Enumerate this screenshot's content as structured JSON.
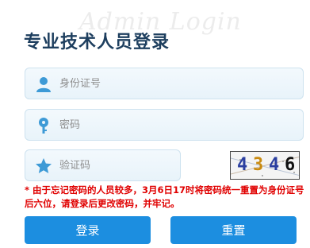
{
  "watermark": "Admin Login",
  "title": "专业技术人员登录",
  "fields": {
    "username": {
      "placeholder": "身份证号",
      "value": "",
      "icon": "user-icon"
    },
    "password": {
      "placeholder": "密码",
      "value": "",
      "icon": "key-icon"
    },
    "captcha": {
      "placeholder": "验证码",
      "value": "",
      "icon": "star-icon"
    }
  },
  "captcha_image": {
    "digits": [
      "4",
      "3",
      "4",
      "6"
    ],
    "colors": [
      "#2b3fa0",
      "#c98a10",
      "#2b3fa0",
      "#111111"
    ]
  },
  "notice": "* 由于忘记密码的人员较多，3月6日17时将密码统一重置为身份证号后六位，请登录后更改密码，并牢记。",
  "buttons": {
    "login": "登录",
    "reset": "重置"
  },
  "colors": {
    "accent": "#1c8ee0",
    "title": "#1d3e5e",
    "notice": "#e00000",
    "icon": "#3d9ad6"
  }
}
